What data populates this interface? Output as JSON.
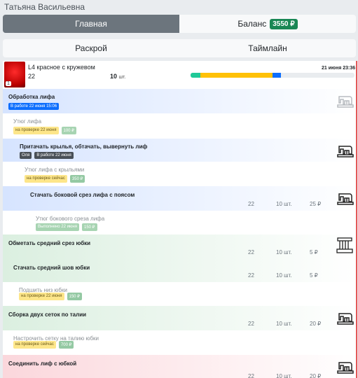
{
  "user": {
    "name": "Татьяна Васильевна"
  },
  "tabs": {
    "main": "Главная",
    "balance": "Баланс",
    "balance_amount": "3550 ₽"
  },
  "subtabs": {
    "cut": "Раскрой",
    "timeline": "Таймлайн"
  },
  "product": {
    "name": "L4 красное с кружевом",
    "size": "22",
    "qty": "10",
    "qty_unit": "шт.",
    "date": "21 июня 23:36",
    "badge": "1",
    "progress": [
      {
        "color": "#20c997",
        "fraction": 0.06
      },
      {
        "color": "#ffc107",
        "fraction": 0.44
      },
      {
        "color": "#0d6efd",
        "fraction": 0.05
      }
    ]
  },
  "colors": {
    "accent_red": "#e45757",
    "brand_green": "#198754"
  },
  "ops": [
    {
      "title": "Обработка лифа",
      "badges": [
        "В работе 22 июня 15:06"
      ],
      "icon": "sewing-machine-icon"
    },
    {
      "title": "Утюг лифа",
      "badges": [
        "на проверке 22 июня",
        "100 ₽"
      ]
    },
    {
      "title": "Притачать крылья, обтачать, вывернуть лиф",
      "badges": [
        "Оля",
        "В работе 22 июня"
      ],
      "icon": "sewing-machine-icon"
    },
    {
      "title": "Утюг лифа с крыльями",
      "badges": [
        "на проверке сейчас",
        "350 ₽"
      ]
    },
    {
      "title": "Стачать боковой срез лифа с поясом",
      "size": "22",
      "qty": "10 шт.",
      "price": "25 ₽",
      "icon": "sewing-machine-icon"
    },
    {
      "title": "Утюг бокового среза лифа",
      "badges": [
        "Выполнено 22 июня",
        "150 ₽"
      ]
    },
    {
      "title": "Обметать средний срез юбки",
      "size": "22",
      "qty": "10 шт.",
      "price": "5 ₽",
      "icon": "overlock-icon"
    },
    {
      "title": "Стачать средний шов юбки",
      "size": "22",
      "qty": "10 шт.",
      "price": "5 ₽"
    },
    {
      "title": "Подшить низ юбки",
      "badges": [
        "на проверке 22 июня",
        "150 ₽"
      ]
    },
    {
      "title": "Сборка двух сеток по талии",
      "size": "22",
      "qty": "10 шт.",
      "price": "20 ₽",
      "icon": "sewing-machine-icon"
    },
    {
      "title": "Настрочить сетку на талию юбки",
      "badges": [
        "на проверке сейчас",
        "700 ₽"
      ]
    },
    {
      "title": "Соединить лиф с юбкой",
      "size": "22",
      "qty": "10 шт.",
      "price": "20 ₽",
      "icon": "sewing-machine-icon"
    }
  ]
}
